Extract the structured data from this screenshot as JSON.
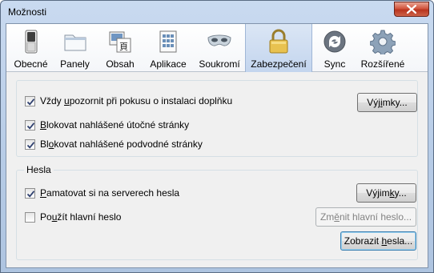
{
  "window": {
    "title": "Možnosti"
  },
  "toolbar": {
    "panes": [
      {
        "label": "Obecné",
        "icon": "switch-icon"
      },
      {
        "label": "Panely",
        "icon": "folder-tabs-icon"
      },
      {
        "label": "Obsah",
        "icon": "content-icon"
      },
      {
        "label": "Aplikace",
        "icon": "applications-icon"
      },
      {
        "label": "Soukromí",
        "icon": "mask-icon"
      },
      {
        "label": "Zabezpečení",
        "icon": "padlock-icon",
        "selected": true
      },
      {
        "label": "Sync",
        "icon": "sync-icon"
      },
      {
        "label": "Rozšířené",
        "icon": "gear-icon"
      }
    ]
  },
  "security": {
    "warn_addons": {
      "label_pre": "Vždy ",
      "label_u": "u",
      "label_post": "pozornit při pokusu o instalaci doplňku",
      "checked": true
    },
    "exceptions_label_pre": "Výj",
    "exceptions_label_u": "i",
    "exceptions_label_post": "mky...",
    "block_attack": {
      "label_u": "B",
      "label_post": "lokovat nahlášené útočné stránky",
      "checked": true
    },
    "block_forgery": {
      "label_pre": "Bl",
      "label_u": "o",
      "label_post": "kovat nahlášené podvodné stránky",
      "checked": true
    }
  },
  "passwords": {
    "caption": "Hesla",
    "remember": {
      "label_u": "P",
      "label_post": "amatovat si na serverech hesla",
      "checked": true
    },
    "exceptions_label_pre": "Výjim",
    "exceptions_label_u": "k",
    "exceptions_label_post": "y...",
    "master": {
      "label_pre": "Po",
      "label_u": "u",
      "label_post": "žít hlavní heslo",
      "checked": false
    },
    "change_master_label_pre": "Zm",
    "change_master_label_u": "ě",
    "change_master_label_post": "nit hlavní heslo...",
    "show_passwords_label_pre": "Zobrazit ",
    "show_passwords_label_u": "h",
    "show_passwords_label_post": "esla..."
  }
}
